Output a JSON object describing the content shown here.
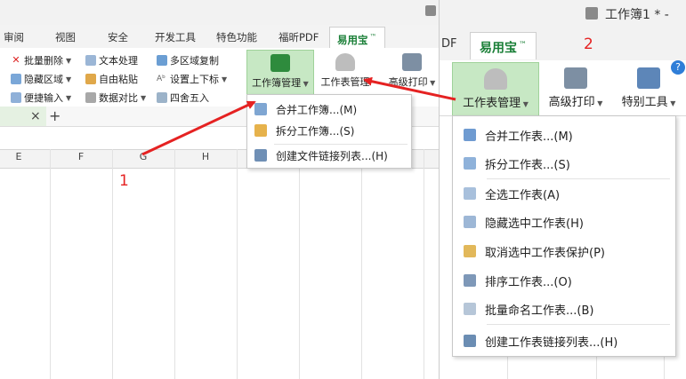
{
  "left": {
    "tabs": [
      "审阅",
      "视图",
      "安全",
      "开发工具",
      "特色功能",
      "福昕PDF"
    ],
    "active_tab": {
      "label": "易用宝",
      "version": "™"
    },
    "ribbon_small": [
      {
        "label": "批量删除",
        "icon": "x-icon",
        "dropdown": true
      },
      {
        "label": "文本处理",
        "icon": "wrench-icon",
        "dropdown": false
      },
      {
        "label": "多区域复制",
        "icon": "copy-icon",
        "dropdown": false
      },
      {
        "label": "隐藏区域",
        "icon": "hide-area-icon",
        "dropdown": true
      },
      {
        "label": "自由粘贴",
        "icon": "paste-icon",
        "dropdown": false
      },
      {
        "label": "设置上下标",
        "icon": "superscript-icon",
        "dropdown": true
      },
      {
        "label": "便捷输入",
        "icon": "input-icon",
        "dropdown": true
      },
      {
        "label": "数据对比",
        "icon": "compare-icon",
        "dropdown": true
      },
      {
        "label": "四舍五入",
        "icon": "round-icon",
        "dropdown": false
      }
    ],
    "big_buttons": [
      {
        "label": "工作簿管理",
        "icon": "excel-workbook-icon"
      },
      {
        "label": "工作表管理",
        "icon": "sheet-eraser-icon"
      },
      {
        "label": "高级打印",
        "icon": "printer-icon"
      }
    ],
    "doc_tab_close": "×",
    "doc_tab_add": "+",
    "columns": [
      "E",
      "F",
      "G",
      "H"
    ],
    "menu_items": [
      {
        "label": "合并工作簿...(M)",
        "icon": "merge-workbook-icon"
      },
      {
        "label": "拆分工作簿...(S)",
        "icon": "split-workbook-icon"
      },
      {
        "label": "创建文件链接列表...(H)",
        "icon": "file-link-list-icon"
      }
    ],
    "annotation": "1"
  },
  "right": {
    "title": "工作簿1 * -",
    "tab_partial": "DF",
    "active_tab": {
      "label": "易用宝",
      "version": "™"
    },
    "annotation": "2",
    "big_buttons": [
      {
        "label": "工作表管理",
        "icon": "sheet-eraser-icon"
      },
      {
        "label": "高级打印",
        "icon": "printer-icon"
      },
      {
        "label": "特别工具",
        "icon": "special-tools-icon"
      }
    ],
    "menu_items": [
      {
        "label": "合并工作表...(M)",
        "icon": "merge-sheet-icon"
      },
      {
        "label": "拆分工作表...(S)",
        "icon": "split-sheet-icon"
      },
      {
        "label": "全选工作表(A)",
        "icon": "select-all-sheets-icon"
      },
      {
        "label": "隐藏选中工作表(H)",
        "icon": "hide-sheet-icon"
      },
      {
        "label": "取消选中工作表保护(P)",
        "icon": "unprotect-sheet-icon"
      },
      {
        "label": "排序工作表...(O)",
        "icon": "sort-sheets-icon"
      },
      {
        "label": "批量命名工作表...(B)",
        "icon": "batch-rename-icon"
      },
      {
        "label": "创建工作表链接列表...(H)",
        "icon": "sheet-link-list-icon"
      }
    ]
  },
  "colors": {
    "accent_green": "#1a7f37",
    "highlight": "#c7e8c4",
    "arrow_red": "#e52222"
  }
}
